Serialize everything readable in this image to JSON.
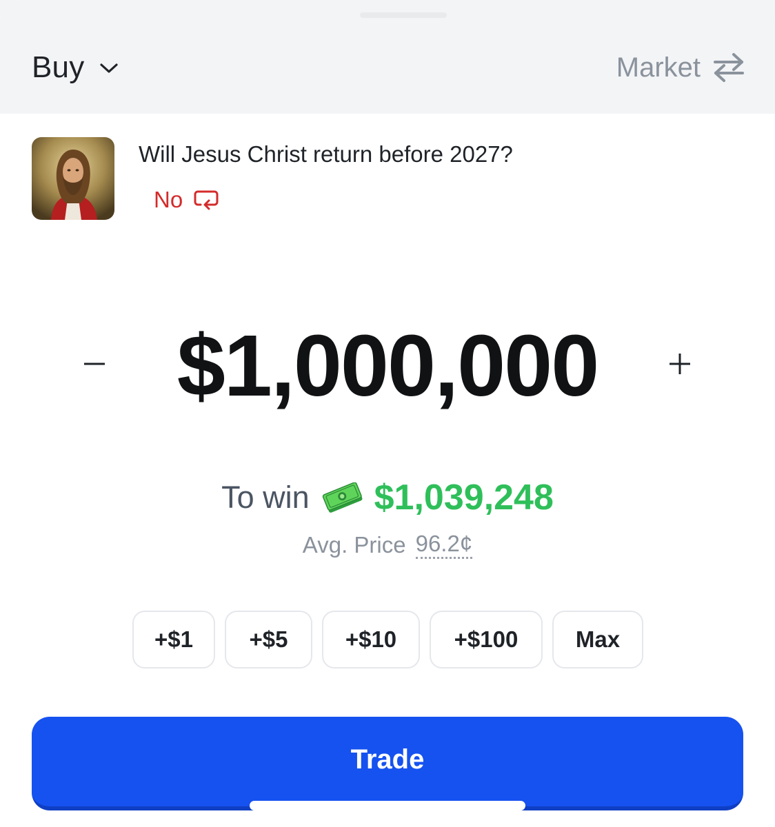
{
  "header": {
    "side_label": "Buy",
    "order_type_label": "Market"
  },
  "market": {
    "title": "Will Jesus Christ return before 2027?",
    "outcome_label": "No",
    "colors": {
      "outcome": "#d42b2b"
    }
  },
  "amount": {
    "value": "$1,000,000",
    "decrement_label": "−",
    "increment_label": "+"
  },
  "payout": {
    "to_win_label": "To win",
    "to_win_value": "$1,039,248",
    "avg_price_label": "Avg. Price",
    "avg_price_value": "96.2¢",
    "colors": {
      "to_win_value": "#2fbf5a"
    }
  },
  "quick_amounts": [
    "+$1",
    "+$5",
    "+$10",
    "+$100",
    "Max"
  ],
  "trade_button": {
    "label": "Trade",
    "color": "#1652f0"
  },
  "icons": {
    "side_dropdown": "chevron-down-icon",
    "order_type": "swap-arrows-icon",
    "outcome_switch": "switch-icon",
    "money": "money-icon"
  }
}
